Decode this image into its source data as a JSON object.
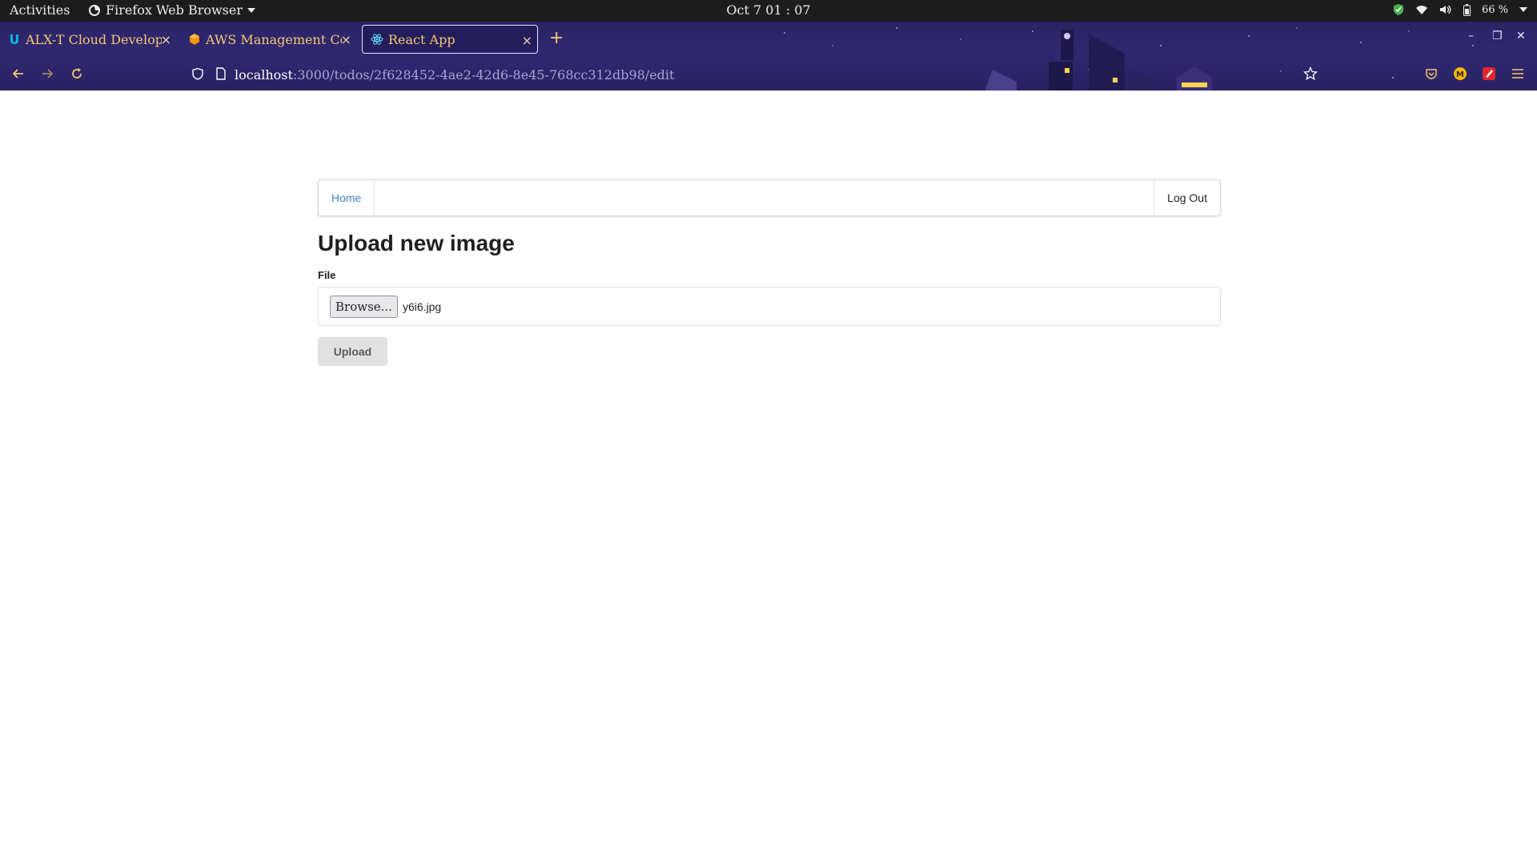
{
  "system_bar": {
    "activities": "Activities",
    "app_menu": "Firefox Web Browser",
    "clock": "Oct 7  01 : 07",
    "battery": "66 %"
  },
  "tabs": [
    {
      "label": "ALX-T Cloud Developer",
      "icon": "udacity-icon",
      "active": false
    },
    {
      "label": "AWS Management Cons",
      "icon": "aws-icon",
      "active": false
    },
    {
      "label": "React App",
      "icon": "react-icon",
      "active": true
    }
  ],
  "url": {
    "host": "localhost",
    "path": ":3000/todos/2f628452-4ae2-42d6-8e45-768cc312db98/edit"
  },
  "app": {
    "menu": {
      "home": "Home",
      "logout": "Log Out"
    },
    "heading": "Upload new image",
    "file_label": "File",
    "browse_label": "Browse...",
    "file_name": "y6i6.jpg",
    "upload_label": "Upload"
  },
  "colors": {
    "tab_text": "#f7c873",
    "chrome_bg": "#2a2366",
    "link": "#4183c4",
    "upload_bg": "#e0e1e2"
  }
}
